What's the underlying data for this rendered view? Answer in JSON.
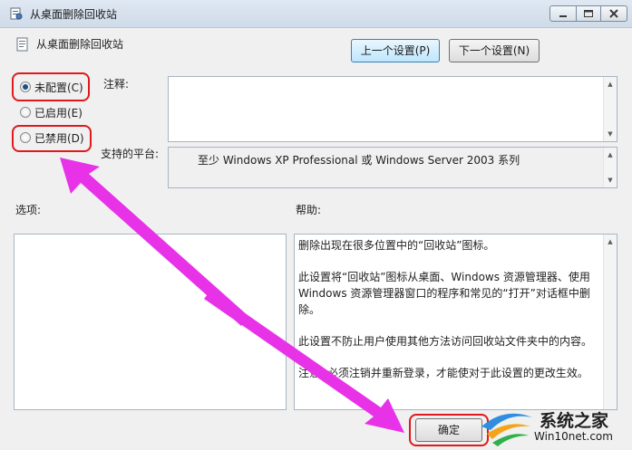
{
  "window": {
    "title": "从桌面删除回收站"
  },
  "header": {
    "policy_name": "从桌面删除回收站",
    "prev_button": "上一个设置(P)",
    "next_button": "下一个设置(N)"
  },
  "state": {
    "options": [
      {
        "label": "未配置(C)",
        "checked": true
      },
      {
        "label": "已启用(E)",
        "checked": false
      },
      {
        "label": "已禁用(D)",
        "checked": false
      }
    ]
  },
  "comment": {
    "label": "注释:",
    "value": ""
  },
  "supported": {
    "label": "支持的平台:",
    "value": "至少 Windows XP Professional 或 Windows Server 2003 系列"
  },
  "options_section": {
    "label": "选项:"
  },
  "help_section": {
    "label": "帮助:",
    "paragraphs": [
      "删除出现在很多位置中的“回收站”图标。",
      "此设置将“回收站”图标从桌面、Windows 资源管理器、使用 Windows 资源管理器窗口的程序和常见的“打开”对话框中删除。",
      "此设置不防止用户使用其他方法访问回收站文件夹中的内容。",
      "注意: 必须注销并重新登录，才能使对于此设置的更改生效。"
    ]
  },
  "footer": {
    "ok_button": "确定"
  },
  "watermark": {
    "main": "系统之家",
    "sub": "Win10net.com"
  },
  "annotation_colors": {
    "highlight_box": "#e0191d",
    "arrow": "#e832e8"
  }
}
